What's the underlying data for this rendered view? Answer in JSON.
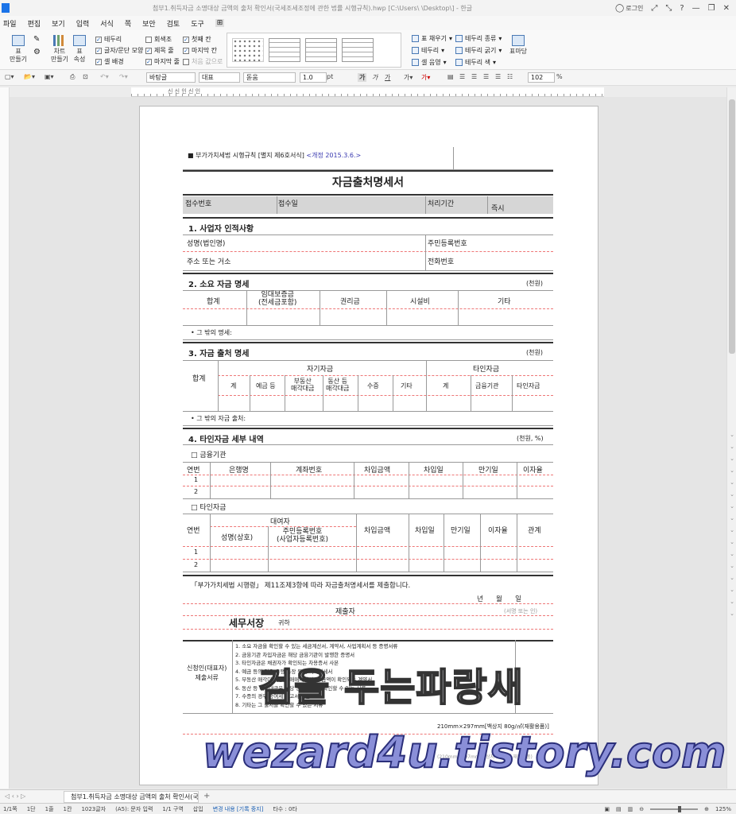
{
  "titlebar": {
    "title": "첨부1.취득자금 소명대상 금액의 출처 확인서(국세조세조정에 관한 법률 시행규칙).hwp [C:\\Users\\        \\Desktop\\] - 한글",
    "login": "로그인",
    "help": "?",
    "min": "—",
    "max": "❐",
    "close": "✕"
  },
  "menu": [
    "파일",
    "편집",
    "보기",
    "입력",
    "서식",
    "쪽",
    "보안",
    "검토",
    "도구",
    "⊞"
  ],
  "ribbon": {
    "buttons": [
      {
        "label": "표\n만들기"
      },
      {
        "label": "차트\n만들기"
      },
      {
        "label": "표\n속성"
      },
      {
        "label": "표마당"
      }
    ],
    "checks": [
      {
        "label": "테두리",
        "checked": true
      },
      {
        "label": "글자/문단 모양",
        "checked": true
      },
      {
        "label": "셀 배경",
        "checked": true
      },
      {
        "label": "회색조",
        "checked": false
      },
      {
        "label": "제목 줄",
        "checked": true
      },
      {
        "label": "마지막 줄",
        "checked": true
      },
      {
        "label": "첫째 칸",
        "checked": true
      },
      {
        "label": "마지막 칸",
        "checked": true
      },
      {
        "label": "처음 값으로",
        "checked": false
      }
    ],
    "right": [
      "표 채우기",
      "테두리 종류",
      "테두리",
      "테두리 굵기",
      "셀 음영",
      "테두리 색"
    ]
  },
  "toolbar": {
    "style": "바탕글",
    "font_group": "대표",
    "font": "돋움",
    "size": "1.0",
    "unit": "pt",
    "zoom": "102",
    "zoom_unit": "%",
    "bold": "가",
    "italic": "가",
    "underline": "가"
  },
  "ruler_label": "신 신 인 신 인",
  "form": {
    "header_line": "■ 부가가치세법 시행규칙 [별지 제6호서식]",
    "revision": "<개정 2015.3.6.>",
    "title": "자금출처명세서",
    "receipt": {
      "no": "접수번호",
      "date": "접수일",
      "period": "처리기간",
      "period_val": "즉시"
    },
    "s1": {
      "title": "1. 사업자 인적사항",
      "name": "성명(법인명)",
      "rrn": "주민등록번호",
      "addr": "주소 또는 거소",
      "phone": "전화번호"
    },
    "s2": {
      "title": "2. 소요 자금 명세",
      "unit": "(천원)",
      "cols": [
        "합계",
        "임대보증금\n(전세금포함)",
        "권리금",
        "시설비",
        "기타"
      ],
      "note": "• 그 밖의 명세:"
    },
    "s3": {
      "title": "3. 자금 출처 명세",
      "unit": "(천원)",
      "total": "합계",
      "own": "자기자금",
      "other": "타인자금",
      "cols": [
        "계",
        "예금 등",
        "부동산\n매각대금",
        "동산 등\n매각대금",
        "수증",
        "기타",
        "계",
        "금융기관",
        "타인자금"
      ],
      "note": "• 그 밖의 자금 출처:"
    },
    "s4": {
      "title": "4. 타인자금 세부 내역",
      "unit": "(천원, %)",
      "fin_label": "□ 금융기관",
      "fin_cols": [
        "연번",
        "은행명",
        "계좌번호",
        "차입금액",
        "차입일",
        "만기일",
        "이자율"
      ],
      "rows": [
        "1",
        "2"
      ],
      "oth_label": "□ 타인자금",
      "lender": "대여자",
      "oth_cols": [
        "연번",
        "성명(상호)",
        "주민등록번호\n(사업자등록번호)",
        "차입금액",
        "차입일",
        "만기일",
        "이자율",
        "관계"
      ]
    },
    "statement": "「부가가치세법 시행령」 제11조제3항에 따라 자금출처명세서를 제출합니다.",
    "date_fields": "년      월      일",
    "submitter": "제출자",
    "sign": "(서명 또는 인)",
    "office": "세무서장",
    "honorific": "귀하",
    "attach_label": "신청인(대표자)\n제출서류",
    "attach": [
      "1. 소요 자금을 확인할 수 있는 세금계산서, 계약서, 사업계획서 등 증명서류",
      "2. 금융기관 차입자금은 해당 금융기관이 발행한 증명서",
      "3. 타인자금은 채권자가 확인되는 차용증서 사본",
      "4. 예금 등의 경우 은행 통장 등의 거래명세서",
      "5. 부동산 매각대금 등은 매매계약서 및 금액이 확인되는 계약서",
      "6. 동산 등 매각대금은 해당 동산 매각을 확인할 수 있는 서류",
      "7. 수증의 경우 증여세 신고서 사본",
      "8. 기타는 그 출처를 확인할 수 있는 서류"
    ],
    "paper": "210mm×297mm[백상지 80g/㎡(재활용품)]",
    "form_no": "(210mm×297mm 백상지 80g/㎡ 재활용품)"
  },
  "tab": {
    "label": "첨부1.취득자금 소명대상 금액의 출처 확인서(국···",
    "add": "+"
  },
  "status": [
    "1/1쪽",
    "1단",
    "1줄",
    "1칸",
    "1023글자",
    "(A5): 문자 입력",
    "1/1 구역",
    "삽입",
    "변경 내용 [기록 중지]",
    "타수 : 0타"
  ],
  "zoom_status": "125%",
  "watermark": {
    "korean": "검을 두는파랑새",
    "url": "wezard4u.tistory.com"
  }
}
